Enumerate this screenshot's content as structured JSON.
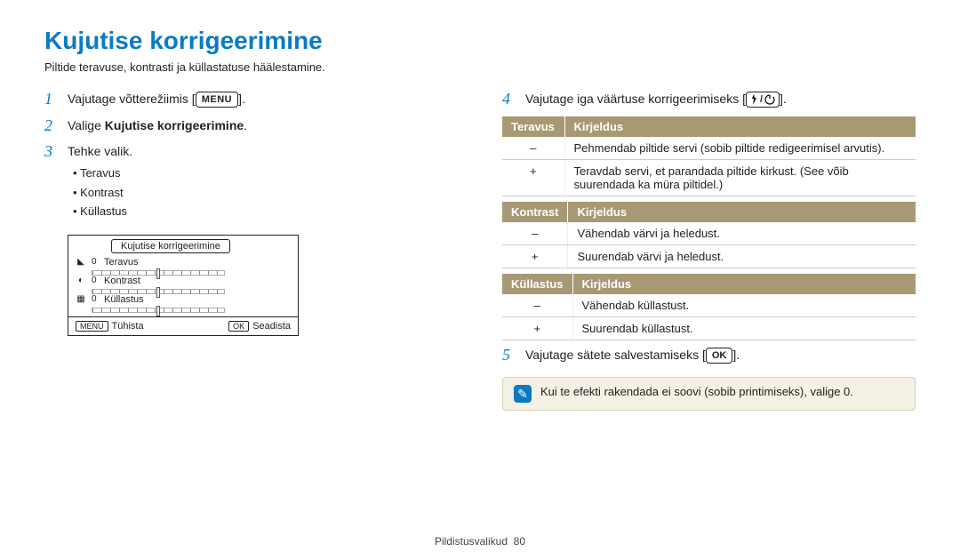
{
  "title": "Kujutise korrigeerimine",
  "subtitle": "Piltide teravuse, kontrasti ja küllastatuse häälestamine.",
  "left": {
    "step1": "Vajutage võtterežiimis [",
    "step1_after": "].",
    "step2_before": "Valige ",
    "step2_bold": "Kujutise korrigeerimine",
    "step2_after": ".",
    "step3": "Tehke valik.",
    "bullets": [
      "Teravus",
      "Kontrast",
      "Küllastus"
    ]
  },
  "mock": {
    "panel_title": "Kujutise korrigeerimine",
    "row1_label": "Teravus",
    "row2_label": "Kontrast",
    "row3_label": "Küllastus",
    "value": "0",
    "footer_left_key": "MENU",
    "footer_left": "Tühista",
    "footer_right_key": "OK",
    "footer_right": "Seadista"
  },
  "right": {
    "step4_before": "Vajutage iga väärtuse korrigeerimiseks [",
    "step4_after": "].",
    "step5_before": "Vajutage sätete salvestamiseks [",
    "step5_after": "].",
    "tables": [
      {
        "col1": "Teravus",
        "col2": "Kirjeldus",
        "rows": [
          [
            "–",
            "Pehmendab piltide servi (sobib piltide redigeerimisel arvutis)."
          ],
          [
            "+",
            "Teravdab servi, et parandada piltide kirkust. (See võib suurendada ka müra piltidel.)"
          ]
        ]
      },
      {
        "col1": "Kontrast",
        "col2": "Kirjeldus",
        "rows": [
          [
            "–",
            "Vähendab värvi ja heledust."
          ],
          [
            "+",
            "Suurendab värvi ja heledust."
          ]
        ]
      },
      {
        "col1": "Küllastus",
        "col2": "Kirjeldus",
        "rows": [
          [
            "–",
            "Vähendab küllastust."
          ],
          [
            "+",
            "Suurendab küllastust."
          ]
        ]
      }
    ],
    "note": "Kui te efekti rakendada ei soovi (sobib printimiseks), valige 0."
  },
  "footer": {
    "section": "Pildistusvalikud",
    "page": "80"
  }
}
